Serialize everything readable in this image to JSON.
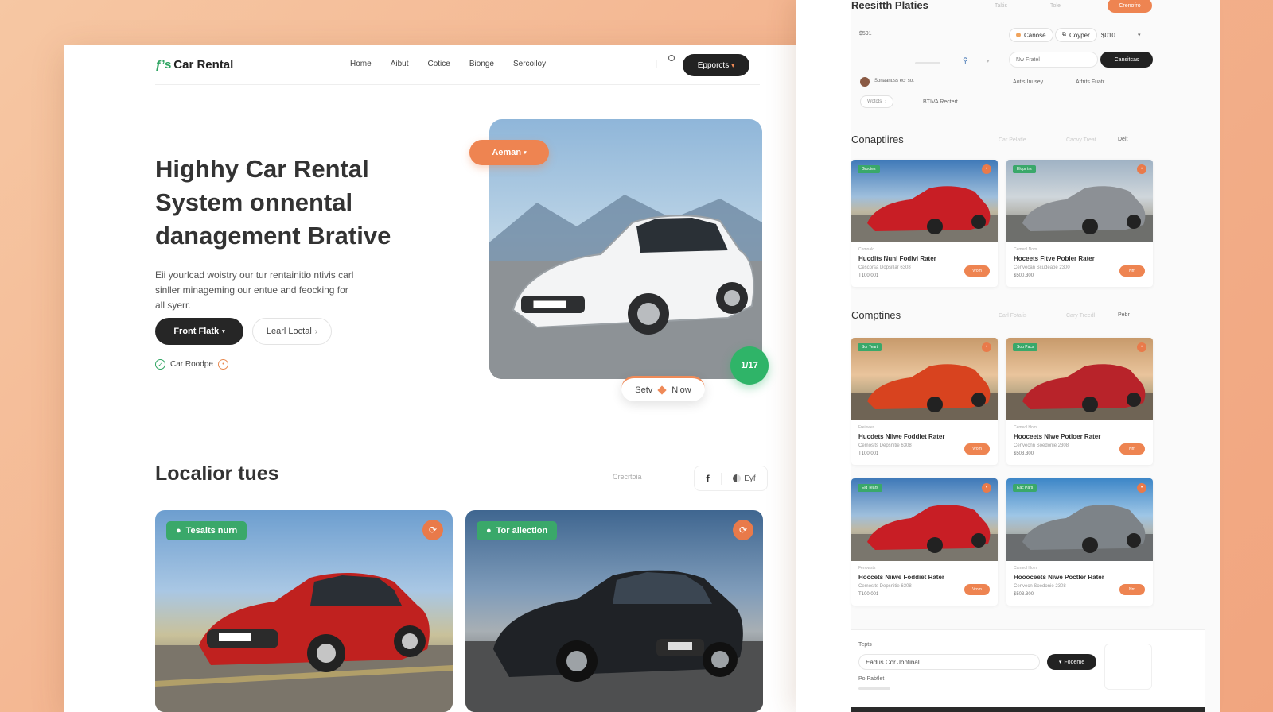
{
  "main": {
    "logo": {
      "mark": "ƒ’s",
      "text": "Car Rental"
    },
    "nav": [
      "Home",
      "Aibut",
      "Cotice",
      "Bionge",
      "Sercoiloy"
    ],
    "nav_cta": "Epporcts",
    "hero": {
      "title_lines": [
        "Highhy Car Rental",
        "System onnental",
        "danagement Brative"
      ],
      "desc_lines": [
        "Eii yourlcad woistry our tur rentainitio ntivis carl",
        "sinller minageming our entue and feocking for",
        "all syerr."
      ],
      "primary_button": "Front Flatk",
      "secondary_button": "Learl Loctal",
      "badge_text": "Car Roodpe",
      "image_tag": "Aeman",
      "fab_text": "1/17",
      "pill_left": "Setv",
      "pill_right": "Nlow"
    },
    "section": {
      "title": "Localior tues",
      "meta": "Crecrtoia",
      "share_fb": "f",
      "share_text": "Eyf"
    },
    "cards": [
      {
        "tag": "Tesalts nurn"
      },
      {
        "tag": "Tor allection"
      }
    ]
  },
  "side": {
    "title": "Reesitth Platies",
    "top_meta": [
      "Taltis",
      "Tole"
    ],
    "top_button": "Crenofro",
    "sum_label": "$591",
    "chips": [
      "Canose",
      "Coyper"
    ],
    "amount": "$010",
    "search_placeholder": "Nw Fratel",
    "search_button": "Cansitcas",
    "row_text": "Sonaanuss ecr sot",
    "filter_a": "Aotis Inusey",
    "filter_b": "Atfrits Fuatr",
    "pill_a": "Wotcts",
    "pill_b": "BTIVA Rectert",
    "section1": {
      "title": "Conaptiires",
      "meta": [
        "Car Pelatle",
        "Caovy Treat"
      ],
      "extra": "Delt"
    },
    "section2": {
      "title": "Comptines",
      "meta": [
        "Carl Fotalis",
        "Cary Treedl"
      ],
      "extra": "Pebr"
    },
    "cards": [
      {
        "tag": "Groctes",
        "small": "Cnmnalc",
        "name": "Hucdits Nuni Fodivi Rater",
        "sub": "Cescorsa Dopsitlar 6308",
        "price": "T100.001",
        "btn": "Vrom"
      },
      {
        "tag": "Elopr trs",
        "small": "Cemenl Nom",
        "name": "Hoceets Fitve Pobler Rater",
        "sub": "Cenvecan Scudeabe 2300",
        "price": "$500.300",
        "btn": "Nrrl"
      },
      {
        "tag": "Sor Teart",
        "small": "Freinwes",
        "name": "Hucdets Niiwe Foddiet Rater",
        "sub": "Cemosits Depsnitie 6308",
        "price": "T100.001",
        "btn": "Vrom"
      },
      {
        "tag": "Sou Pacs",
        "small": "Cemecl Hom",
        "name": "Hooceets Niwe Potioer Rater",
        "sub": "Cenvecnn Soedonie 2308",
        "price": "$503.300",
        "btn": "Nrrl"
      },
      {
        "tag": "Eig Tears",
        "small": "Fenowsts",
        "name": "Hoccets Niiwe Foddiet Rater",
        "sub": "Cemosits Depsnitie 6308",
        "price": "T100.001",
        "btn": "Vrom"
      },
      {
        "tag": "Eac Pars",
        "small": "Camecl Hom",
        "name": "Hoooceets Niwe Poctler Rater",
        "sub": "Cenvecn Soedonie 2308",
        "price": "$503.300",
        "btn": "Nrrl"
      }
    ],
    "footer": {
      "label": "Tepts",
      "input_value": "Eadus Cor Jontinal",
      "button": "Fooeme",
      "link": "Po Pabtlet"
    }
  },
  "colors": {
    "accent_orange": "#ee8451",
    "accent_green": "#2fb468",
    "dark": "#222222",
    "background": "#f3b08b"
  }
}
